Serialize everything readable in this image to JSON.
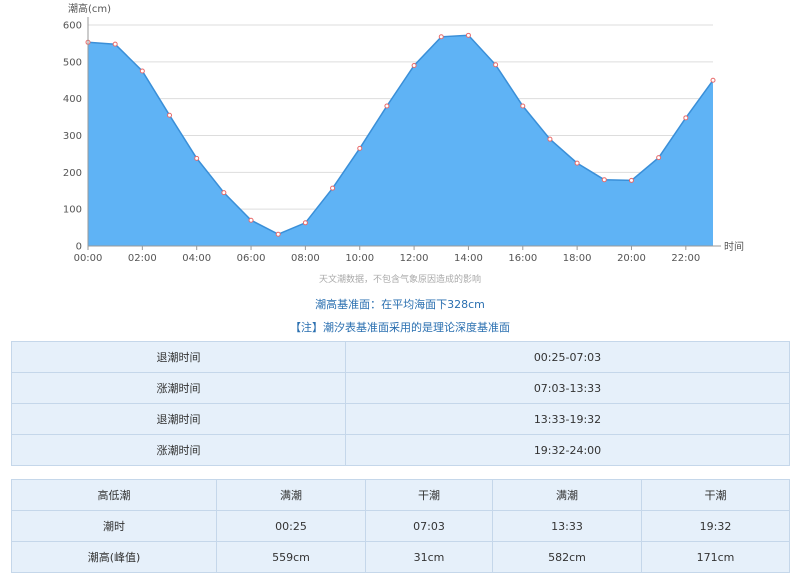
{
  "chart_data": {
    "type": "area",
    "ylabel": "潮高(cm)",
    "xlabel": "时间",
    "ylim": [
      0,
      600
    ],
    "y_ticks": [
      0,
      100,
      200,
      300,
      400,
      500,
      600
    ],
    "x_tick_labels": [
      "00:00",
      "02:00",
      "04:00",
      "06:00",
      "08:00",
      "10:00",
      "12:00",
      "14:00",
      "16:00",
      "18:00",
      "20:00",
      "22:00"
    ],
    "x_hours": [
      0,
      1,
      2,
      3,
      4,
      5,
      6,
      7,
      8,
      9,
      10,
      11,
      12,
      13,
      14,
      15,
      16,
      17,
      18,
      19,
      20,
      21,
      22,
      23
    ],
    "values": [
      553,
      548,
      475,
      355,
      238,
      145,
      70,
      32,
      63,
      157,
      265,
      380,
      490,
      568,
      572,
      492,
      380,
      290,
      225,
      180,
      178,
      240,
      348,
      450
    ],
    "colors": {
      "fill": "#5fb3f5",
      "line": "#3a8fd8",
      "marker": "#e86a6a",
      "grid": "#dddddd"
    }
  },
  "source_note": "天文潮数据，不包含气象原因造成的影响",
  "datum": "潮高基准面：在平均海面下328cm",
  "note": "【注】潮汐表基准面采用的是理论深度基准面",
  "tide_periods": [
    {
      "label": "退潮时间",
      "value": "00:25-07:03"
    },
    {
      "label": "涨潮时间",
      "value": "07:03-13:33"
    },
    {
      "label": "退潮时间",
      "value": "13:33-19:32"
    },
    {
      "label": "涨潮时间",
      "value": "19:32-24:00"
    }
  ],
  "extremes": {
    "header": [
      "高低潮",
      "满潮",
      "干潮",
      "满潮",
      "干潮"
    ],
    "time_row": [
      "潮时",
      "00:25",
      "07:03",
      "13:33",
      "19:32"
    ],
    "height_row": [
      "潮高(峰值)",
      "559cm",
      "31cm",
      "582cm",
      "171cm"
    ]
  }
}
